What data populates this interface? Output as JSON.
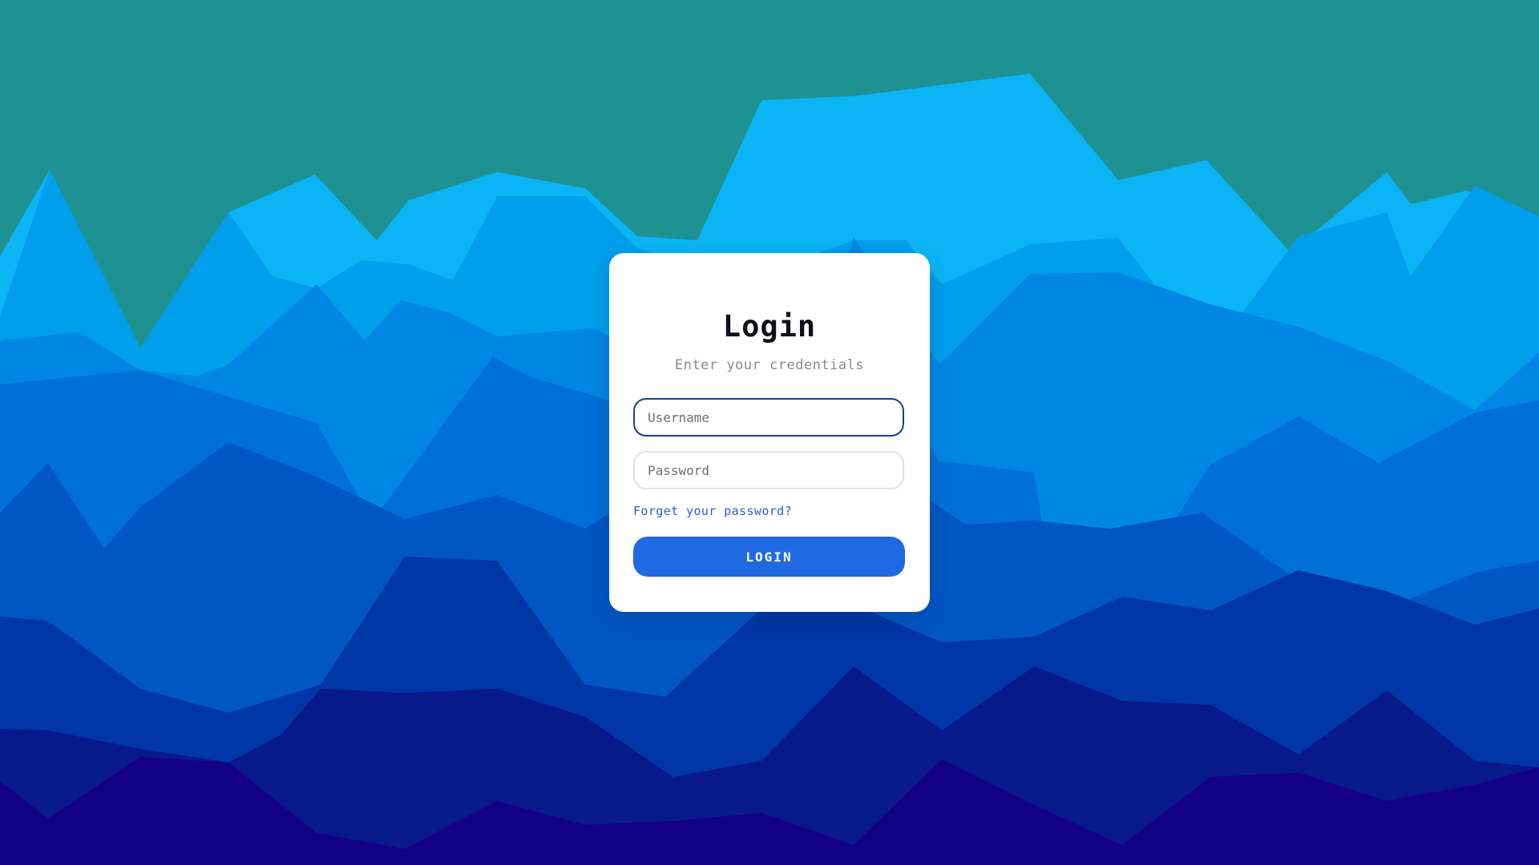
{
  "login": {
    "title": "Login",
    "subtitle": "Enter your credentials",
    "username_placeholder": "Username",
    "password_placeholder": "Password",
    "forgot_link": "Forget your password?",
    "submit_label": "LOGIN"
  },
  "background": {
    "sky_color": "#1e9193",
    "layer_colors": [
      "#0bb5f5",
      "#009fec",
      "#0087e3",
      "#0070d6",
      "#0056c3",
      "#0036a6",
      "#07198b",
      "#140085"
    ]
  }
}
